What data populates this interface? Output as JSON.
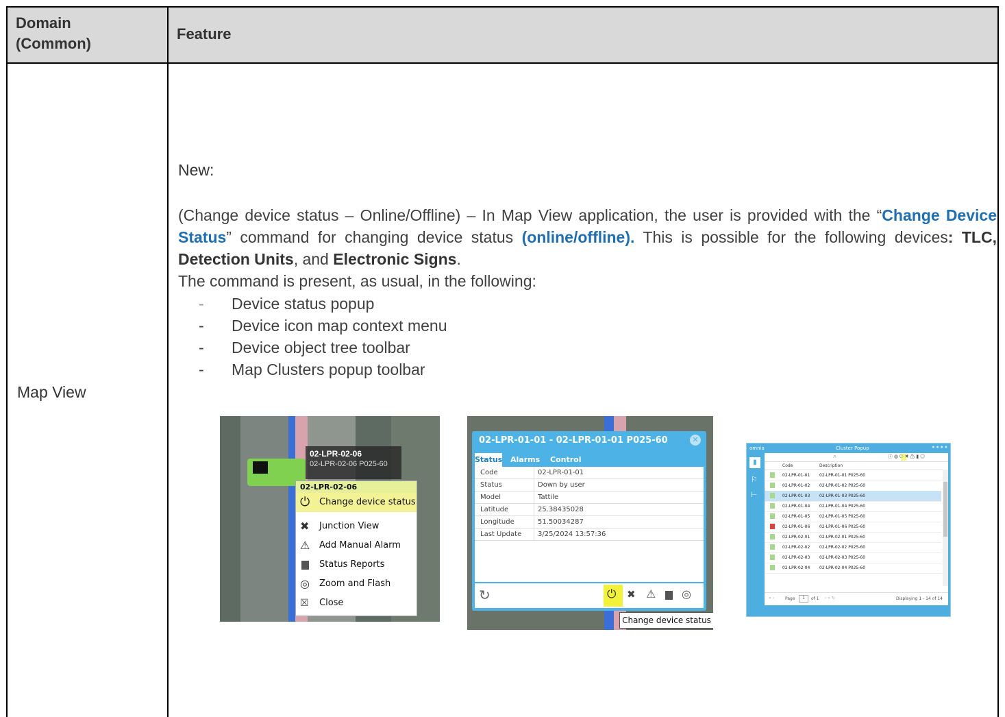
{
  "header": {
    "domain_line1": "Domain",
    "domain_line2": "(Common)",
    "feature": "Feature"
  },
  "row": {
    "domain": "Map View",
    "new_label": "New:",
    "para": {
      "t1": "(Change device status – Online/Offline) – In Map View application, the user is provided with the “",
      "cmd": "Change Device Status",
      "t2": "” command for changing device status ",
      "onoff": "(online/offline).",
      "t3": " This is possible for the following devices",
      "colon": ": ",
      "dev1": "TLC, Detection Units",
      "t4": ", and ",
      "dev2": "Electronic Signs",
      "t5": "."
    },
    "intro": "The command is present, as usual, in the following:",
    "bullets": [
      "Device status popup",
      "Device icon map context menu",
      "Device object tree toolbar",
      "Map Clusters popup toolbar"
    ]
  },
  "shot1": {
    "label_code": "02-LPR-02-06",
    "label_desc": "02-LPR-02-06 P025-60",
    "menu_title": "02-LPR-02-06",
    "menu_items": [
      "Change device status",
      "Junction View",
      "Add Manual Alarm",
      "Status Reports",
      "Zoom and Flash",
      "Close"
    ]
  },
  "shot2": {
    "title": "02-LPR-01-01 - 02-LPR-01-01 P025-60",
    "tabs": [
      "Status",
      "Alarms",
      "Control"
    ],
    "fields": [
      {
        "k": "Code",
        "v": "02-LPR-01-01"
      },
      {
        "k": "Status",
        "v": "Down by user"
      },
      {
        "k": "Model",
        "v": "Tattile"
      },
      {
        "k": "Latitude",
        "v": "25.38435028"
      },
      {
        "k": "Longitude",
        "v": "51.50034287"
      },
      {
        "k": "Last Update",
        "v": "3/25/2024 13:57:36"
      }
    ],
    "tooltip": "Change device status"
  },
  "shot3": {
    "brand": "omnia",
    "title": "Cluster Popup",
    "col_code": "Code",
    "col_desc": "Description",
    "rows": [
      {
        "code": "02-LPR-01-01",
        "desc": "02-LPR-01-01 P025-60"
      },
      {
        "code": "02-LPR-01-02",
        "desc": "02-LPR-01-02 P025-60"
      },
      {
        "code": "02-LPR-01-03",
        "desc": "02-LPR-01-03 P025-60"
      },
      {
        "code": "02-LPR-01-04",
        "desc": "02-LPR-01-04 P025-60"
      },
      {
        "code": "02-LPR-01-05",
        "desc": "02-LPR-01-05 P025-60"
      },
      {
        "code": "02-LPR-01-06",
        "desc": "02-LPR-01-06 P025-60"
      },
      {
        "code": "02-LPR-02-01",
        "desc": "02-LPR-02-01 P025-60"
      },
      {
        "code": "02-LPR-02-02",
        "desc": "02-LPR-02-02 P025-60"
      },
      {
        "code": "02-LPR-02-03",
        "desc": "02-LPR-02-03 P025-60"
      },
      {
        "code": "02-LPR-02-04",
        "desc": "02-LPR-02-04 P025-60"
      }
    ],
    "page_label": "Page",
    "page_num": "1",
    "page_of": "of 1",
    "displaying": "Displaying 1 - 14 of 14"
  }
}
